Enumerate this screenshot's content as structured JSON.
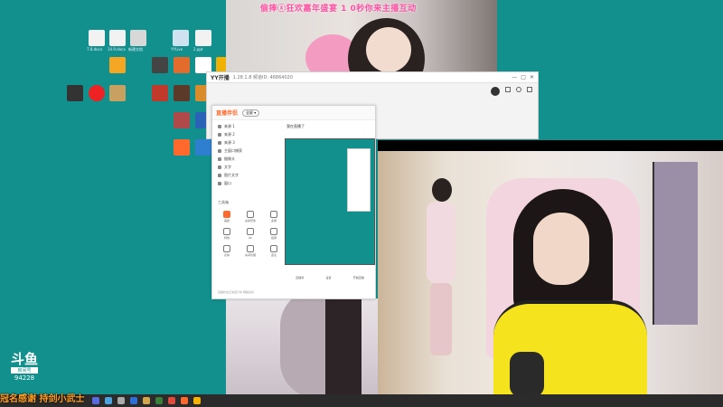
{
  "banner": {
    "text": "偷摔ⓧ狂欢嘉年盛宴 1 0秒你来主播互动"
  },
  "desktop": {
    "labels": [
      "7.8.docx",
      "14.9.docx",
      "新建文档",
      "YYLive",
      "2.ppt"
    ]
  },
  "yy_window": {
    "title": "YY开播",
    "version": "1.28.1.8 频道ID: 46864020",
    "controls": [
      "—",
      "□",
      "✕"
    ]
  },
  "app_window": {
    "logo": "直播伴侣",
    "mode": "全屏 ▾",
    "title": "我在直播了",
    "nav": [
      "来源 1",
      "来源 2",
      "来源 3",
      "主窗口捕获",
      "摄像头",
      "文字",
      "图片文字",
      "窗口"
    ],
    "tools_title": "工具箱",
    "tools": [
      "美颜",
      "虚拟形象",
      "多屏",
      "特效",
      "PK",
      "截屏",
      "表情",
      "房间管理",
      "连麦"
    ],
    "footer": [
      "直播间",
      "设置",
      "开始直播"
    ],
    "status": "直播状态正常运行中 网络良好"
  },
  "douyu": {
    "mark": "斗鱼",
    "tag": "房间号",
    "room": "94228"
  },
  "ticker": {
    "text": "冠名感谢 持剑小武士"
  },
  "colors": {
    "desktop": "#11908e",
    "accent": "#ff6a2c",
    "banner": "#ff4fa1"
  }
}
